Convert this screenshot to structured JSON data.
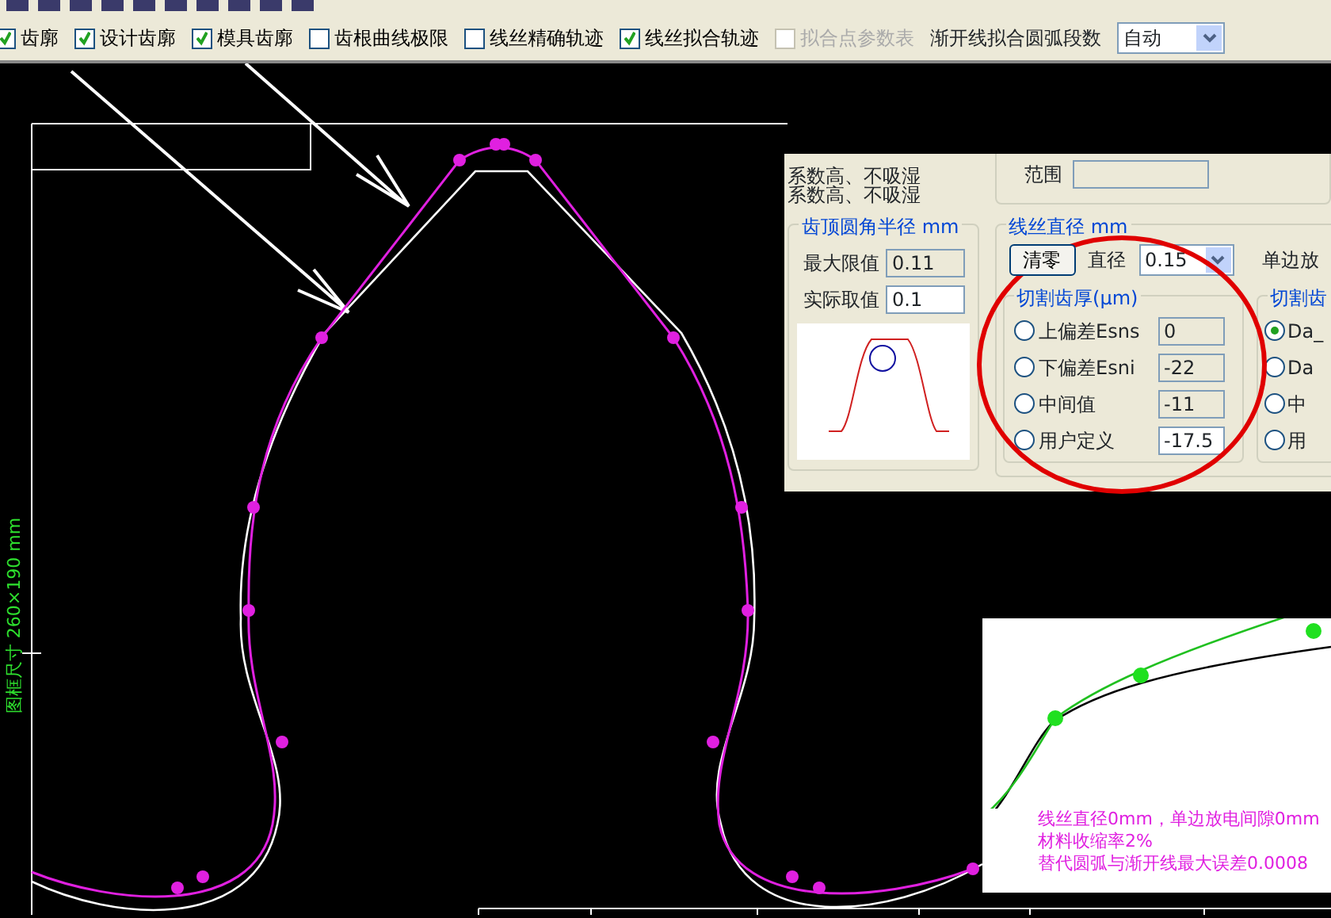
{
  "toolbar_checks": [
    {
      "label": "齿廓",
      "checked": true,
      "disabled": false
    },
    {
      "label": "设计齿廓",
      "checked": true,
      "disabled": false
    },
    {
      "label": "模具齿廓",
      "checked": true,
      "disabled": false
    },
    {
      "label": "齿根曲线极限",
      "checked": false,
      "disabled": false
    },
    {
      "label": "线丝精确轨迹",
      "checked": false,
      "disabled": false
    },
    {
      "label": "线丝拟合轨迹",
      "checked": true,
      "disabled": false
    },
    {
      "label": "拟合点参数表",
      "checked": false,
      "disabled": true
    }
  ],
  "arc_segments": {
    "label": "渐开线拟合圆弧段数",
    "value": "自动"
  },
  "frame_size_label": "图框尺寸 260×190 mm",
  "dialog": {
    "material_lines": [
      "系数高、不吸湿",
      "系数高、不吸湿"
    ],
    "shrink_group": {
      "range_label": "范围"
    },
    "tip_radius_group": {
      "title": "齿顶圆角半径 mm",
      "fields": [
        {
          "label": "最大限值",
          "value": "0.11",
          "editable": false
        },
        {
          "label": "实际取值",
          "value": "0.1",
          "editable": true
        }
      ]
    },
    "wire_group": {
      "title": "线丝直径 mm",
      "clear_button": "清零",
      "diameter_label": "直径",
      "diameter_value": "0.15",
      "side_label": "单边放"
    },
    "thickness_group": {
      "title": "切割齿厚(μm)",
      "options": [
        {
          "label": "上偏差Esns",
          "value": "0",
          "selected": false,
          "editable": false
        },
        {
          "label": "下偏差Esni",
          "value": "-22",
          "selected": false,
          "editable": false
        },
        {
          "label": "中间值",
          "value": "-11",
          "selected": false,
          "editable": false
        },
        {
          "label": "用户定义",
          "value": "-17.5",
          "selected": false,
          "editable": true
        }
      ]
    },
    "cut_group": {
      "title": "切割齿",
      "options": [
        {
          "label": "Da_",
          "selected": true
        },
        {
          "label": "Da",
          "selected": false
        },
        {
          "label": "中",
          "selected": false
        },
        {
          "label": "用",
          "selected": false
        }
      ]
    }
  },
  "inset_notes": [
    "线丝直径0mm，单边放电间隙0mm",
    "材料收缩率2%",
    "替代圆弧与渐开线最大误差0.0008"
  ]
}
